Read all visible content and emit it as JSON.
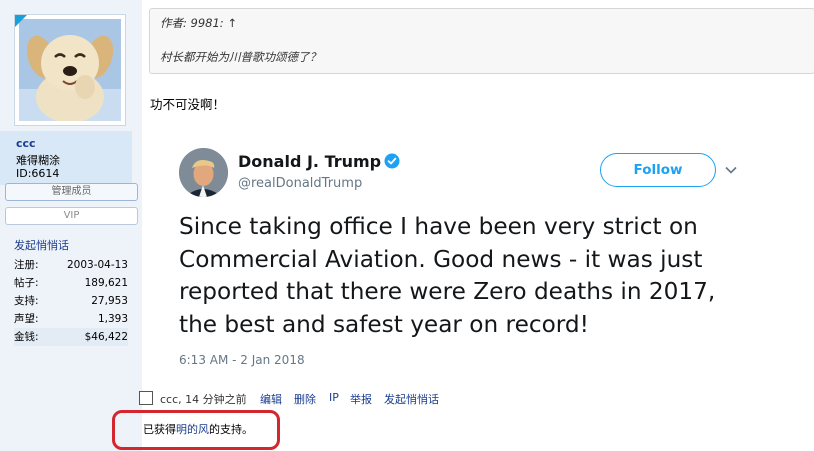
{
  "user": {
    "name": "ccc",
    "nickname": "难得糊涂",
    "id_text": "ID:6614",
    "badge_admin": "管理成员",
    "badge_vip": "VIP",
    "chat_link": "发起悄悄话",
    "stats": [
      {
        "label": "注册:",
        "value": "2003-04-13"
      },
      {
        "label": "帖子:",
        "value": "189,621"
      },
      {
        "label": "支持:",
        "value": "27,953"
      },
      {
        "label": "声望:",
        "value": "1,393"
      },
      {
        "label": "金钱:",
        "value": "$46,422"
      }
    ]
  },
  "quote": {
    "author": "作者: 9981: ↑",
    "text": "村长都开始为川普歌功颂德了？"
  },
  "reply": "功不可没啊！",
  "tweet": {
    "name": "Donald J. Trump",
    "handle": "@realDonaldTrump",
    "follow_label": "Follow",
    "text": "Since taking office I have been very strict on Commercial Aviation. Good news - it was just reported that there were Zero deaths in 2017, the best and safest year on record!",
    "time": "6:13 AM - 2 Jan 2018",
    "colors": {
      "accent": "#1da1f2",
      "text": "#14171a",
      "muted": "#657786"
    }
  },
  "footer": {
    "meta": "ccc, 14 分钟之前",
    "edit": "编辑",
    "delete": "删除",
    "ip": "IP",
    "report": "举报",
    "chat": "发起悄悄话",
    "support_prefix": "已获得",
    "support_user": "明的风",
    "support_suffix": "的支持。"
  },
  "icons": [
    "avatar-corner-icon",
    "verified-icon",
    "chevron-down-icon"
  ]
}
